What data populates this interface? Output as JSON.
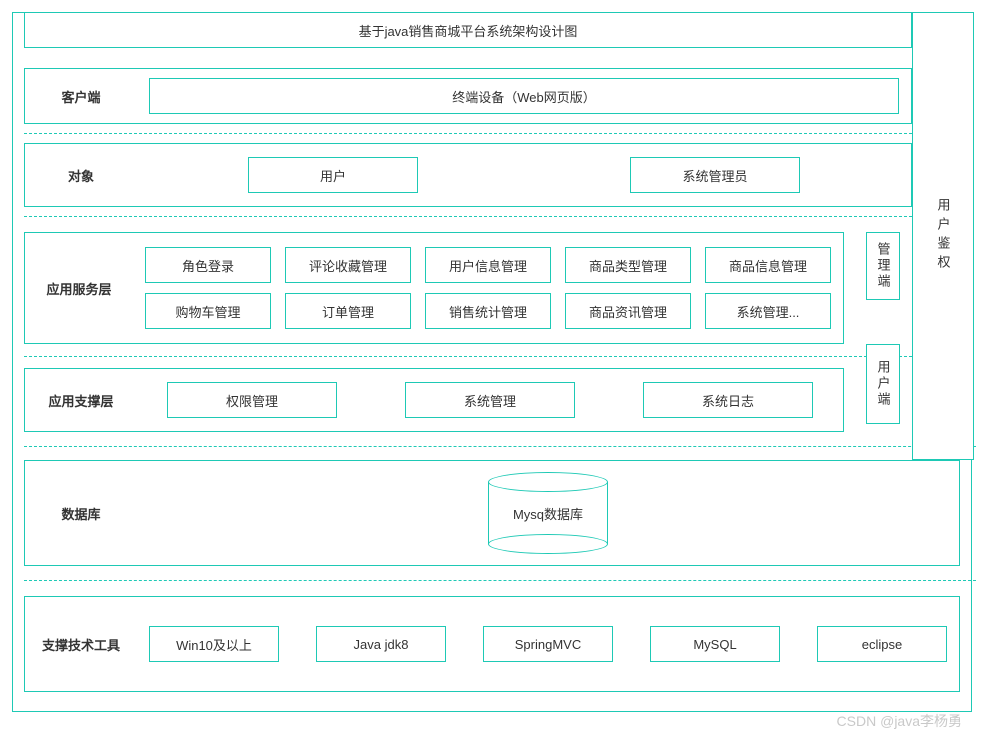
{
  "title": "基于java销售商城平台系统架构设计图",
  "side_auth": "用户鉴权",
  "lanes": {
    "client": {
      "label": "客户端",
      "box": "终端设备（Web网页版）"
    },
    "object": {
      "label": "对象",
      "items": [
        "用户",
        "系统管理员"
      ]
    },
    "service": {
      "label": "应用服务层",
      "row1": [
        "角色登录",
        "评论收藏管理",
        "用户信息管理",
        "商品类型管理",
        "商品信息管理"
      ],
      "row2": [
        "购物车管理",
        "订单管理",
        "销售统计管理",
        "商品资讯管理",
        "系统管理..."
      ]
    },
    "support": {
      "label": "应用支撑层",
      "items": [
        "权限管理",
        "系统管理",
        "系统日志"
      ]
    },
    "db": {
      "label": "数据库",
      "cyl": "Mysq数据库"
    },
    "tech": {
      "label": "支撑技术工具",
      "items": [
        "Win10及以上",
        "Java jdk8",
        "SpringMVC",
        "MySQL",
        "eclipse"
      ]
    }
  },
  "pills": {
    "admin": "管理端",
    "user": "用户端"
  },
  "watermark": "CSDN @java李杨勇"
}
